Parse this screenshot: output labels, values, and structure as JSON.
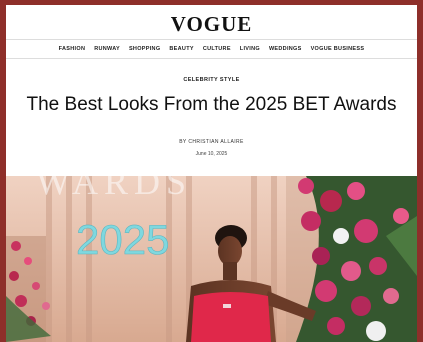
{
  "brand": {
    "logo_text": "VOGUE"
  },
  "nav": {
    "items": [
      "FASHION",
      "RUNWAY",
      "SHOPPING",
      "BEAUTY",
      "CULTURE",
      "LIVING",
      "WEDDINGS",
      "VOGUE BUSINESS"
    ]
  },
  "article": {
    "kicker": "CELEBRITY STYLE",
    "title": "The Best Looks From the 2025 BET Awards",
    "byline": "BY CHRISTIAN ALLAIRE",
    "date": "June 10, 2025"
  },
  "hero": {
    "backdrop_text": "2025",
    "colors": {
      "backdrop": "#e7c3b2",
      "dress": "#e0284a",
      "year_text": "#7fd8df",
      "flowers": "#d23a72"
    }
  }
}
